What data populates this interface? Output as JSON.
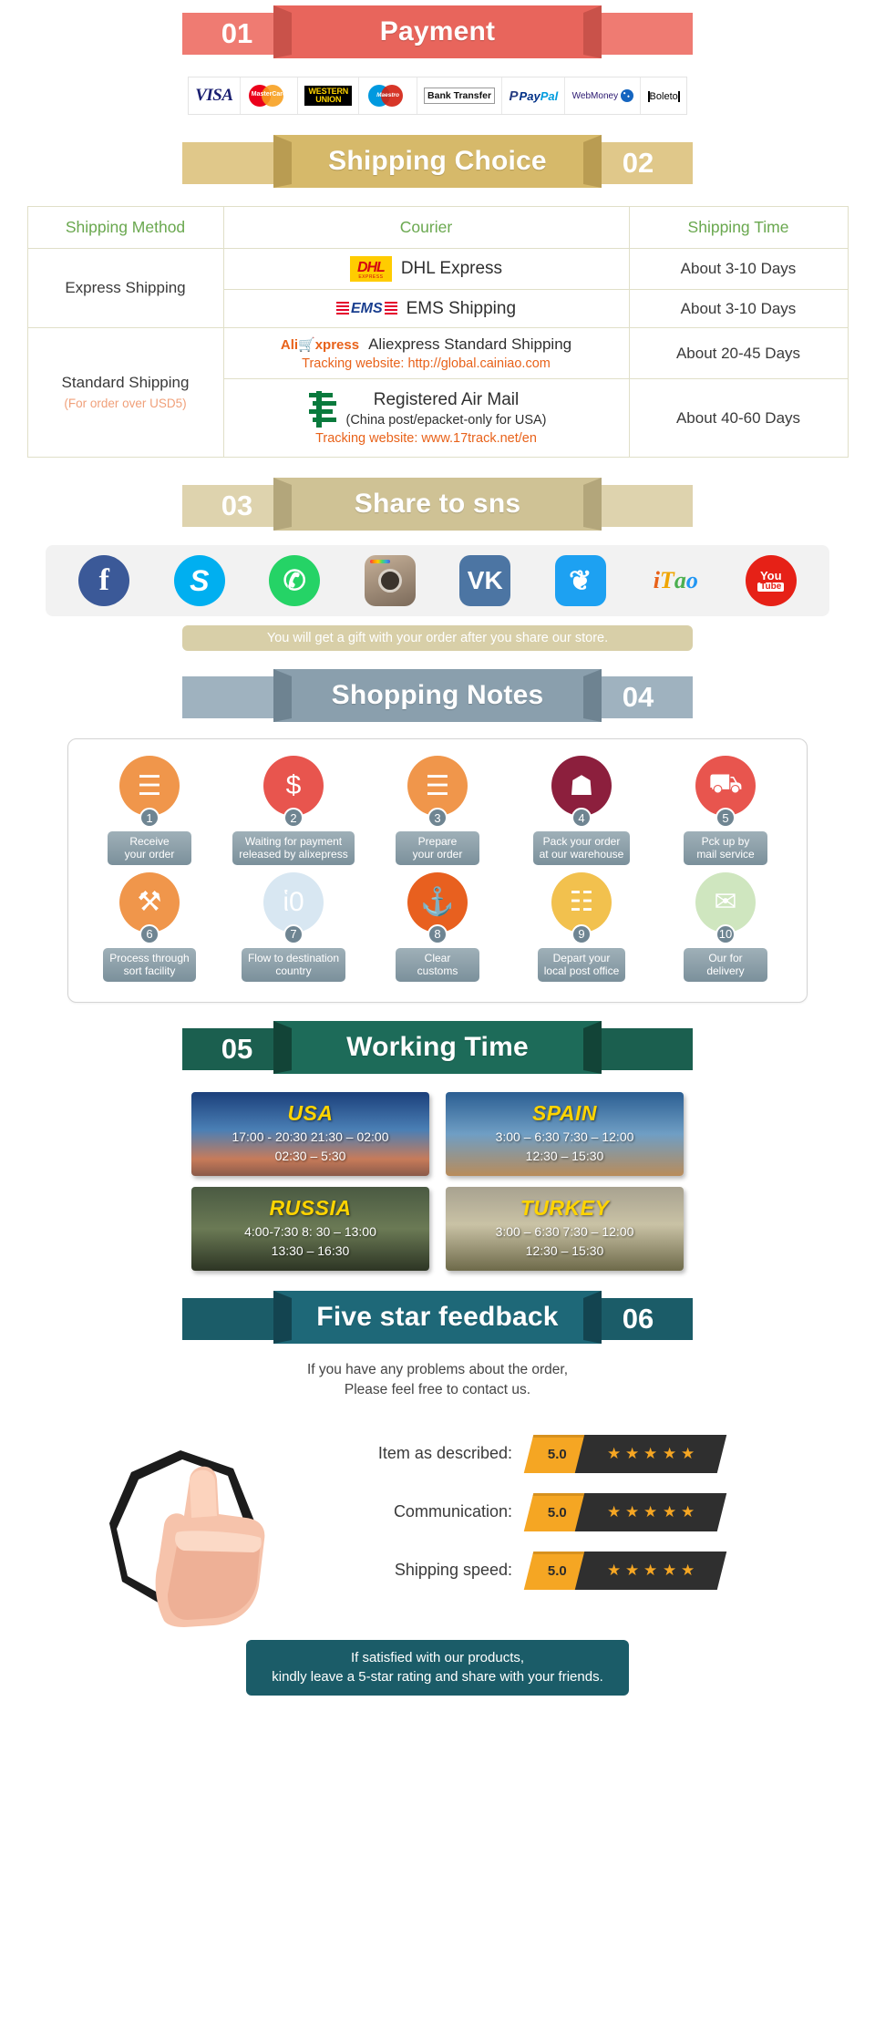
{
  "sections": {
    "payment": {
      "number": "01",
      "title": "Payment",
      "color": "#e8655c",
      "methods": [
        {
          "name": "visa-logo",
          "label": "VISA"
        },
        {
          "name": "mastercard-logo",
          "label": "MasterCard"
        },
        {
          "name": "western-union-logo",
          "label_line1": "WESTERN",
          "label_line2": "UNION"
        },
        {
          "name": "maestro-logo",
          "label": "Maestro"
        },
        {
          "name": "bank-transfer-logo",
          "label": "Bank Transfer"
        },
        {
          "name": "paypal-logo",
          "label_a": "Pay",
          "label_b": "Pal"
        },
        {
          "name": "webmoney-logo",
          "label": "WebMoney"
        },
        {
          "name": "boleto-logo",
          "label": "Boleto"
        }
      ]
    },
    "shipping": {
      "number": "02",
      "title": "Shipping Choice",
      "color": "#d6b96a",
      "headers": [
        "Shipping Method",
        "Courier",
        "Shipping Time"
      ],
      "rows": [
        {
          "method": "Express Shipping",
          "method_sub": "",
          "items": [
            {
              "logo": "dhl-logo",
              "courier": "DHL Express",
              "courier_sub": "",
              "tracking": "",
              "time": "About 3-10 Days"
            },
            {
              "logo": "ems-logo",
              "courier": "EMS Shipping",
              "courier_sub": "",
              "tracking": "",
              "time": "About 3-10 Days"
            }
          ]
        },
        {
          "method": "Standard Shipping",
          "method_sub": "(For order over USD5)",
          "items": [
            {
              "logo": "aliexpress-logo",
              "courier": "Aliexpress Standard Shipping",
              "courier_sub": "",
              "tracking": "Tracking website: http://global.cainiao.com",
              "time": "About 20-45 Days"
            },
            {
              "logo": "china-post-logo",
              "courier": "Registered Air Mail",
              "courier_sub": "(China post/epacket-only for USA)",
              "tracking": "Tracking website: www.17track.net/en",
              "time": "About 40-60 Days"
            }
          ]
        }
      ]
    },
    "sns": {
      "number": "03",
      "title": "Share to sns",
      "color": "#cfc295",
      "icons": [
        {
          "name": "facebook-icon",
          "glyph": "f"
        },
        {
          "name": "skype-icon",
          "glyph": "S"
        },
        {
          "name": "whatsapp-icon",
          "glyph": "✆"
        },
        {
          "name": "instagram-icon",
          "glyph": ""
        },
        {
          "name": "vk-icon",
          "glyph": "VK"
        },
        {
          "name": "twitter-icon",
          "glyph": "❦"
        },
        {
          "name": "itao-icon",
          "glyph": "iTao"
        },
        {
          "name": "youtube-icon",
          "glyph": "You"
        }
      ],
      "youtube_sub": "Tube",
      "note": "You will get a gift with your order after you share our store."
    },
    "notes": {
      "number": "04",
      "title": "Shopping Notes",
      "color": "#8a9fad",
      "steps": [
        {
          "num": "1",
          "icon": "document-icon",
          "glyph": "☰",
          "bg": "#f0964b",
          "label": "Receive\nyour order"
        },
        {
          "num": "2",
          "icon": "money-bag-icon",
          "glyph": "$",
          "bg": "#e8554e",
          "label": "Waiting for payment\nreleased by alixepress"
        },
        {
          "num": "3",
          "icon": "document-edit-icon",
          "glyph": "☰",
          "bg": "#f0964b",
          "label": "Prepare\nyour order"
        },
        {
          "num": "4",
          "icon": "gift-box-icon",
          "glyph": "☗",
          "bg": "#8c1f3d",
          "label": "Pack your order\nat our warehouse"
        },
        {
          "num": "5",
          "icon": "mail-truck-icon",
          "glyph": "⛟",
          "bg": "#e8554e",
          "label": "Pck up by\nmail service"
        },
        {
          "num": "6",
          "icon": "sort-facility-icon",
          "glyph": "⚒",
          "bg": "#f0964b",
          "label": "Process through\nsort facility"
        },
        {
          "num": "7",
          "icon": "globe-icon",
          "glyph": "ἱ0",
          "bg": "#d8e7f2",
          "label": "Flow to destination\ncountry"
        },
        {
          "num": "8",
          "icon": "anchor-customs-icon",
          "glyph": "⚓",
          "bg": "#e8601f",
          "label": "Clear\ncustoms"
        },
        {
          "num": "9",
          "icon": "postman-icon",
          "glyph": "☷",
          "bg": "#f2c14e",
          "label": "Depart your\nlocal post office"
        },
        {
          "num": "10",
          "icon": "parcel-delivery-icon",
          "glyph": "✉",
          "bg": "#cfe6bf",
          "label": "Our for\ndelivery"
        }
      ]
    },
    "working_time": {
      "number": "05",
      "title": "Working Time",
      "color": "#1b5f4f",
      "cards": [
        {
          "country": "USA",
          "line1": "17:00 - 20:30  21:30 – 02:00",
          "line2": "02:30 – 5:30",
          "theme": "wt-usa"
        },
        {
          "country": "SPAIN",
          "line1": "3:00 – 6:30   7:30 – 12:00",
          "line2": "12:30 – 15:30",
          "theme": "wt-spain"
        },
        {
          "country": "RUSSIA",
          "line1": "4:00-7:30   8: 30 – 13:00",
          "line2": "13:30 – 16:30",
          "theme": "wt-russia"
        },
        {
          "country": "TURKEY",
          "line1": "3:00 – 6:30   7:30 – 12:00",
          "line2": "12:30 – 15:30",
          "theme": "wt-turkey"
        }
      ]
    },
    "feedback": {
      "number": "06",
      "title": "Five star feedback",
      "color": "#1b5c68",
      "intro_line1": "If you have any problems about the order,",
      "intro_line2": "Please feel free to contact us.",
      "ratings": [
        {
          "label": "Item as described:",
          "score": "5.0",
          "stars": 5
        },
        {
          "label": "Communication:",
          "score": "5.0",
          "stars": 5
        },
        {
          "label": "Shipping speed:",
          "score": "5.0",
          "stars": 5
        }
      ],
      "footer_line1": "If satisfied with our products,",
      "footer_line2": "kindly leave a 5-star rating and share with your friends."
    }
  }
}
